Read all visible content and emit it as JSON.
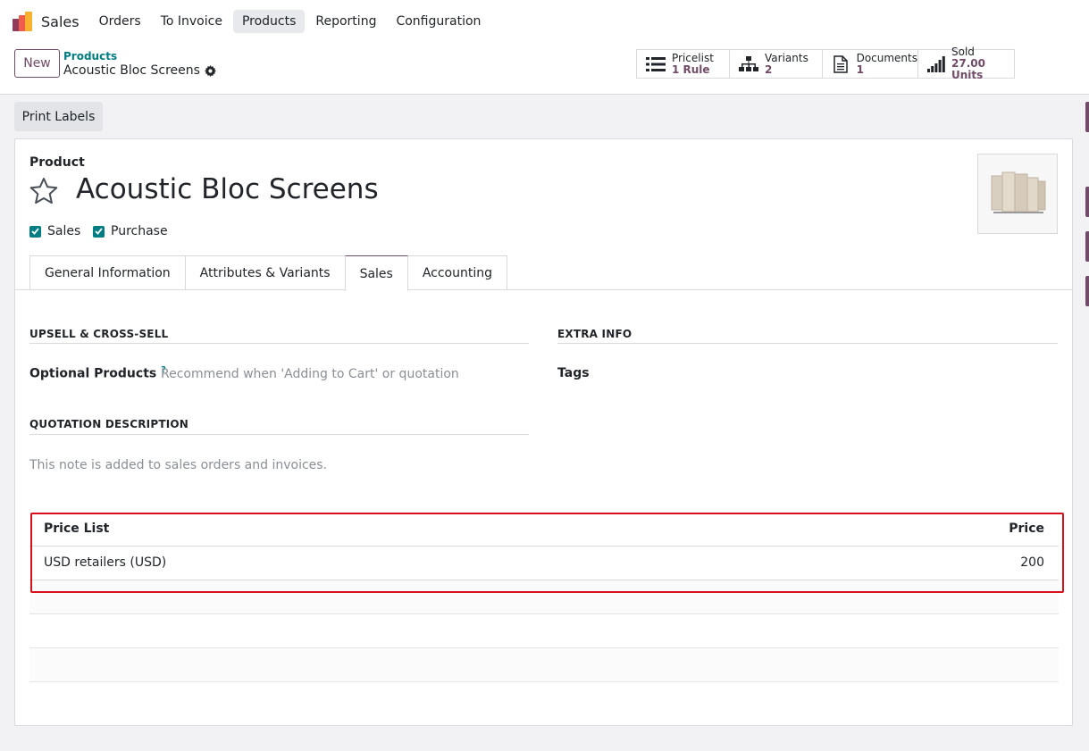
{
  "navbar": {
    "app_name": "Sales",
    "menu": [
      "Orders",
      "To Invoice",
      "Products",
      "Reporting",
      "Configuration"
    ],
    "active": "Products"
  },
  "control": {
    "new_label": "New",
    "breadcrumb_parent": "Products",
    "breadcrumb_current": "Acoustic Bloc Screens"
  },
  "stats": [
    {
      "icon": "list-icon",
      "label": "Pricelist",
      "value": "1 Rule"
    },
    {
      "icon": "sitemap-icon",
      "label": "Variants",
      "value": "2"
    },
    {
      "icon": "document-icon",
      "label": "Documents",
      "value": "1"
    },
    {
      "icon": "signal-bars-icon",
      "label": "Sold",
      "value": "27.00 Units"
    }
  ],
  "actions": {
    "print_labels": "Print Labels"
  },
  "product": {
    "label": "Product",
    "name": "Acoustic Bloc Screens",
    "can_be_sold_label": "Sales",
    "can_be_purchased_label": "Purchase",
    "image_alt": "product-image"
  },
  "tabs": [
    "General Information",
    "Attributes & Variants",
    "Sales",
    "Accounting"
  ],
  "active_tab": "Sales",
  "sales_tab": {
    "upsell_title": "UPSELL & CROSS-SELL",
    "optional_products_label": "Optional Products",
    "optional_products_help": "?",
    "optional_products_placeholder": "Recommend when 'Adding to Cart' or quotation",
    "extra_info_title": "EXTRA INFO",
    "tags_label": "Tags",
    "quotation_title": "QUOTATION DESCRIPTION",
    "quotation_placeholder": "This note is added to sales orders and invoices."
  },
  "pricelist_table": {
    "col_pricelist": "Price List",
    "col_price": "Price",
    "rows": [
      {
        "pricelist": "USD retailers (USD)",
        "price": "200"
      }
    ]
  },
  "colors": {
    "brand": "#714b67",
    "teal": "#017e84",
    "highlight": "#d8101c"
  }
}
